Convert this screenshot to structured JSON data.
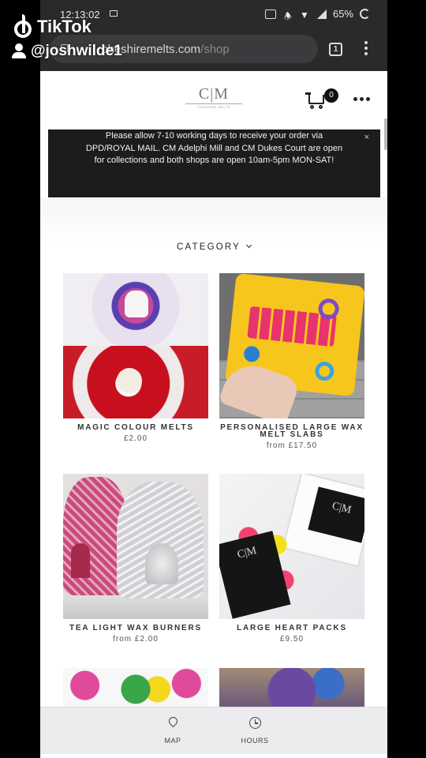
{
  "status_bar": {
    "time": "12:13:02",
    "battery": "65%"
  },
  "browser": {
    "url_host": "cheshiremelts.com",
    "url_path": "/shop",
    "tab_count": "1"
  },
  "tiktok": {
    "brand": "TikTok",
    "handle": "@joshwilde1"
  },
  "site": {
    "logo_mark": "C|M",
    "logo_subtitle": "CHESHIRE MELTS",
    "cart_count": "0"
  },
  "notice": {
    "text": "Please allow 7-10 working days to receive your order via DPD/ROYAL MAIL. CM Adelphi Mill and CM Dukes Court are open for collections and both shops are open 10am-5pm MON-SAT!",
    "close": "×"
  },
  "category_label": "CATEGORY",
  "products": [
    {
      "name": "MAGIC COLOUR MELTS",
      "price": "£2.00"
    },
    {
      "name": "PERSONALISED LARGE WAX MELT SLABS",
      "price": "from £17.50"
    },
    {
      "name": "TEA LIGHT WAX BURNERS",
      "price": "from £2.00"
    },
    {
      "name": "LARGE HEART PACKS",
      "price": "£9.50"
    }
  ],
  "bottom_nav": {
    "map": "MAP",
    "hours": "HOURS"
  },
  "icons": [
    "tiktok-note-icon",
    "user-icon",
    "lock-icon",
    "cart-icon",
    "more-icon",
    "chevron-down-icon",
    "map-pin-icon",
    "clock-icon"
  ]
}
